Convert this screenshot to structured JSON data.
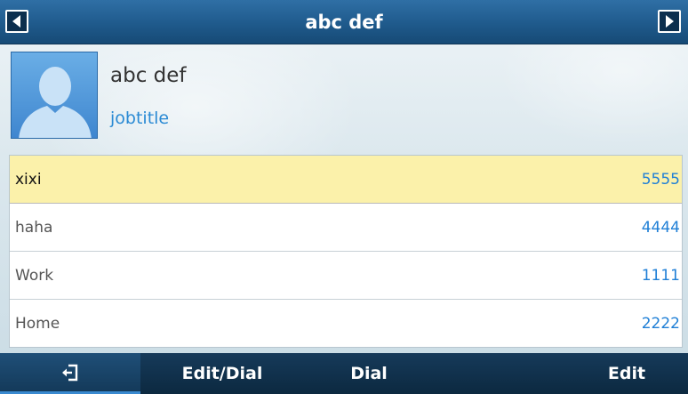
{
  "header": {
    "title": "abc def",
    "prev_icon": "arrow-left-icon",
    "next_icon": "arrow-right-icon"
  },
  "contact": {
    "name": "abc def",
    "job_title": "jobtitle",
    "avatar_icon": "person-silhouette-icon"
  },
  "numbers": [
    {
      "label": "xixi",
      "number": "5555",
      "selected": true
    },
    {
      "label": "haha",
      "number": "4444",
      "selected": false
    },
    {
      "label": "Work",
      "number": "1111",
      "selected": false
    },
    {
      "label": "Home",
      "number": "2222",
      "selected": false
    }
  ],
  "softkeys": {
    "back_icon": "back-exit-icon",
    "edit_dial": "Edit/Dial",
    "dial": "Dial",
    "edit": "Edit"
  },
  "colors": {
    "title_bar": "#1f5a8c",
    "selected_row": "#fbf1aa",
    "number_text": "#1f7fd6",
    "job_title_text": "#2a8ad4",
    "softkey_bar": "#0c2940"
  }
}
